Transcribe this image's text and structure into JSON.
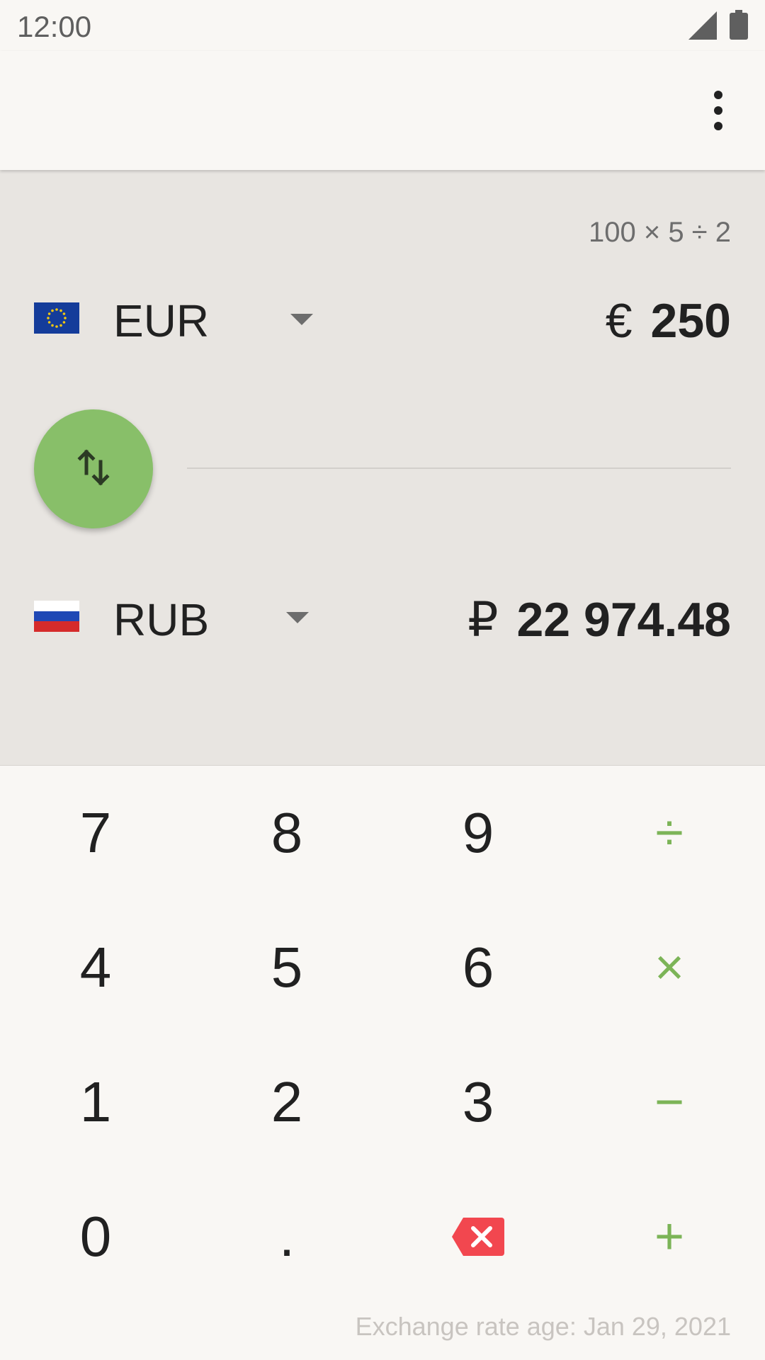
{
  "status_bar": {
    "time": "12:00",
    "signal_icon": "cell-signal-icon",
    "battery_icon": "battery-icon"
  },
  "app_bar": {
    "menu_icon": "overflow-menu-icon"
  },
  "converter": {
    "expression": "100 × 5 ÷ 2",
    "from": {
      "code": "EUR",
      "symbol": "€",
      "amount": "250",
      "flag_icon": "eu-flag-icon"
    },
    "to": {
      "code": "RUB",
      "symbol": "₽",
      "amount": "22 974.48",
      "flag_icon": "russia-flag-icon"
    },
    "swap_icon": "swap-vertical-icon"
  },
  "keypad": {
    "rows": [
      [
        "7",
        "8",
        "9",
        "÷"
      ],
      [
        "4",
        "5",
        "6",
        "×"
      ],
      [
        "1",
        "2",
        "3",
        "−"
      ],
      [
        "0",
        ".",
        "",
        "+"
      ]
    ],
    "backspace_icon": "backspace-icon"
  },
  "footer": {
    "rate_age": "Exchange rate age: Jan 29, 2021"
  },
  "colors": {
    "accent_green": "#88bf69",
    "operator_green": "#7cb457",
    "backspace_red": "#f2474f",
    "panel_background": "#e8e5e1",
    "page_background": "#f9f7f4"
  }
}
